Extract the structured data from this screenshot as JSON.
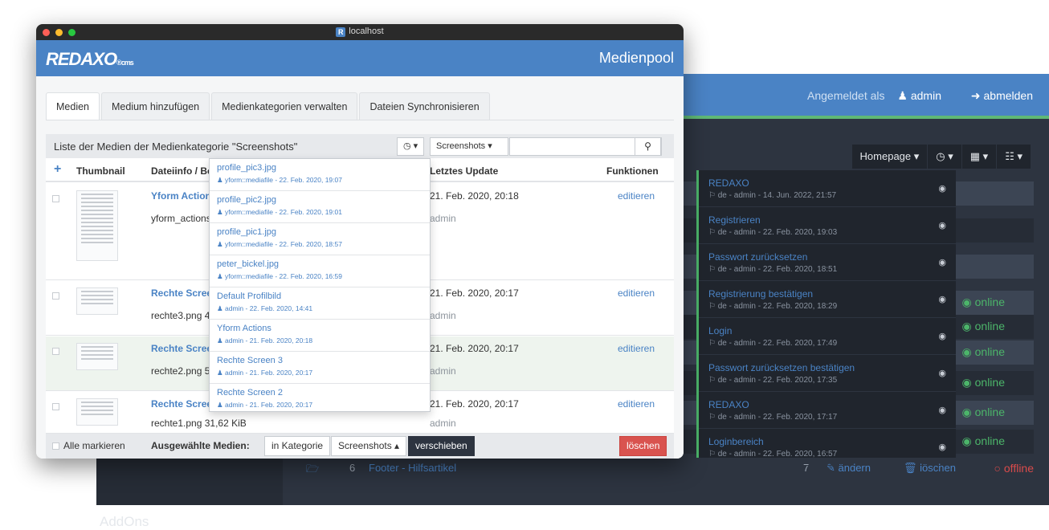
{
  "colors": {
    "brand_blue": "#4a83c5",
    "online_green": "#4cb56a",
    "offline_red": "#d94b4b",
    "delete_red": "#d9534f",
    "dark_bg": "#2d3440"
  },
  "background": {
    "logged_in_label": "Angemeldet als",
    "user": "admin",
    "logout": "abmelden",
    "toolbar": {
      "homepage": "Homepage",
      "history_icon": "clock-icon",
      "table_icon": "grid-icon",
      "calendar_icon": "calendar-icon"
    },
    "addons_label": "AddOns",
    "status_labels": [
      "online",
      "online",
      "online",
      "online",
      "online",
      "online"
    ],
    "footer_row": {
      "id": "6",
      "name": "Footer - Hilfsartikel",
      "prio": "7",
      "edit": "ändern",
      "delete": "löschen",
      "status": "offline"
    },
    "history": [
      {
        "title": "REDAXO",
        "meta": "de - admin - 14. Jun. 2022, 21:57"
      },
      {
        "title": "Registrieren",
        "meta": "de - admin - 22. Feb. 2020, 19:03"
      },
      {
        "title": "Passwort zurücksetzen",
        "meta": "de - admin - 22. Feb. 2020, 18:51"
      },
      {
        "title": "Registrierung bestätigen",
        "meta": "de - admin - 22. Feb. 2020, 18:29"
      },
      {
        "title": "Login",
        "meta": "de - admin - 22. Feb. 2020, 17:49"
      },
      {
        "title": "Passwort zurücksetzen bestätigen",
        "meta": "de - admin - 22. Feb. 2020, 17:35"
      },
      {
        "title": "REDAXO",
        "meta": "de - admin - 22. Feb. 2020, 17:17"
      },
      {
        "title": "Loginbereich",
        "meta": "de - admin - 22. Feb. 2020, 16:57"
      }
    ]
  },
  "window": {
    "url": "localhost",
    "app_logo": "REDAXO",
    "app_logo_suffix": "cms",
    "app_title": "Medienpool",
    "tabs": [
      "Medien",
      "Medium hinzufügen",
      "Medienkategorien verwalten",
      "Dateien Synchronisieren"
    ],
    "panel_title": "Liste der Medien der Medienkategorie \"Screenshots\"",
    "category_select": "Screenshots",
    "search_placeholder": "",
    "columns": {
      "add": "+",
      "thumbnail": "Thumbnail",
      "fileinfo": "Dateiinfo / Be",
      "updated": "Letztes Update",
      "functions": "Funktionen"
    },
    "rows": [
      {
        "title": "Yform Action",
        "file": "yform_actions",
        "updated": "21. Feb. 2020, 20:18",
        "user": "admin",
        "action": "editieren"
      },
      {
        "title": "Rechte Scree",
        "file": "rechte3.png 4",
        "updated": "21. Feb. 2020, 20:17",
        "user": "admin",
        "action": "editieren"
      },
      {
        "title": "Rechte Scree",
        "file": "rechte2.png 5",
        "updated": "21. Feb. 2020, 20:17",
        "user": "admin",
        "action": "editieren"
      },
      {
        "title": "Rechte Scree",
        "file": "rechte1.png 31,62 KiB",
        "updated": "21. Feb. 2020, 20:17",
        "user": "admin",
        "action": "editieren"
      }
    ],
    "footer": {
      "select_all": "Alle markieren",
      "selected_label": "Ausgewählte Medien:",
      "in_category": "in Kategorie",
      "category": "Screenshots",
      "move": "verschieben",
      "delete": "löschen"
    },
    "dropdown": [
      {
        "name": "profile_pic3.jpg",
        "meta": "yform::mediafile - 22. Feb. 2020, 19:07"
      },
      {
        "name": "profile_pic2.jpg",
        "meta": "yform::mediafile - 22. Feb. 2020, 19:01"
      },
      {
        "name": "profile_pic1.jpg",
        "meta": "yform::mediafile - 22. Feb. 2020, 18:57"
      },
      {
        "name": "peter_bickel.jpg",
        "meta": "yform::mediafile - 22. Feb. 2020, 16:59"
      },
      {
        "name": "Default Profilbild",
        "meta": "admin - 22. Feb. 2020, 14:41"
      },
      {
        "name": "Yform Actions",
        "meta": "admin - 21. Feb. 2020, 20:18"
      },
      {
        "name": "Rechte Screen 3",
        "meta": "admin - 21. Feb. 2020, 20:17"
      },
      {
        "name": "Rechte Screen 2",
        "meta": "admin - 21. Feb. 2020, 20:17"
      }
    ]
  }
}
